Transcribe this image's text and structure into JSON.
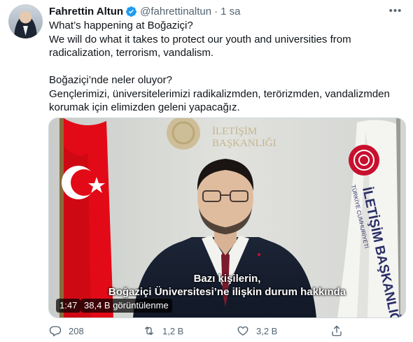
{
  "tweet": {
    "display_name": "Fahrettin Altun",
    "handle": "@fahrettinaltun",
    "separator": "·",
    "time": "1 sa",
    "lines": [
      "What’s happening at Boğaziçi?",
      "We will do what it takes to protect our youth and universities from",
      "radicalization, terrorism, vandalism.",
      "",
      "Boğaziçi’nde neler oluyor?",
      "Gençlerimizi, üniversitelerimizi radikalizmden, terörizmden, vandalizmden",
      "korumak için elimizden geleni yapacağız."
    ]
  },
  "video": {
    "subtitle_line1": "Bazı kişilerin,",
    "subtitle_line2": "Boğaziçi Üniversitesi’ne ilişkin durum hakkında",
    "duration": "1:47",
    "views": "38,4 B görüntülenme",
    "wall_sign_line1": "İLETİŞİM",
    "wall_sign_line2": "BAŞKANLIĞI",
    "flag_text_small": "TÜRKİYE CUMHURİYETİ",
    "flag_text_main": "İLETİŞİM BAŞKANLIĞI"
  },
  "actions": {
    "reply_count": "208",
    "retweet_count": "1,2 B",
    "like_count": "3,2 B"
  },
  "colors": {
    "verified": "#1d9bf0",
    "secondary_text": "#536471",
    "turkish_flag_red": "#e30a17",
    "emblem_red": "#c8102e"
  },
  "icons": {
    "verified": "verified-badge-icon",
    "more": "more-icon",
    "reply": "reply-icon",
    "retweet": "retweet-icon",
    "like": "heart-icon",
    "share": "share-icon"
  }
}
